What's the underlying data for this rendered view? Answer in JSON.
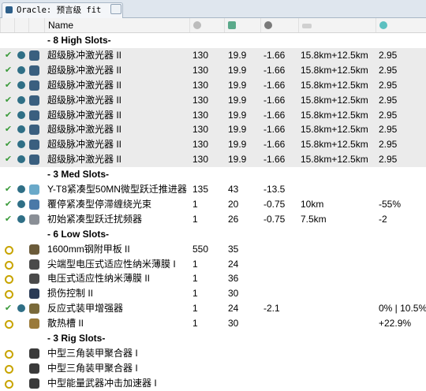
{
  "tab": {
    "title": "Oracle: 预言级 fit",
    "close": "x"
  },
  "columns": {
    "name": "Name"
  },
  "colors": {
    "row_highlight": "#ebebeb",
    "check": "#3a9a3a",
    "ring": "#c8a400"
  },
  "rows": [
    {
      "type": "section",
      "label": "- 8 High Slots-"
    },
    {
      "type": "module",
      "hl": true,
      "state": "check",
      "name": "超级脉冲激光器 II",
      "c1": "130",
      "c2": "19.9",
      "c3": "-1.66",
      "c4": "15.8km+12.5km",
      "c5": "2.95",
      "icon": "laser-icon"
    },
    {
      "type": "module",
      "hl": true,
      "state": "check",
      "name": "超级脉冲激光器 II",
      "c1": "130",
      "c2": "19.9",
      "c3": "-1.66",
      "c4": "15.8km+12.5km",
      "c5": "2.95",
      "icon": "laser-icon"
    },
    {
      "type": "module",
      "hl": true,
      "state": "check",
      "name": "超级脉冲激光器 II",
      "c1": "130",
      "c2": "19.9",
      "c3": "-1.66",
      "c4": "15.8km+12.5km",
      "c5": "2.95",
      "icon": "laser-icon"
    },
    {
      "type": "module",
      "hl": true,
      "state": "check",
      "name": "超级脉冲激光器 II",
      "c1": "130",
      "c2": "19.9",
      "c3": "-1.66",
      "c4": "15.8km+12.5km",
      "c5": "2.95",
      "icon": "laser-icon"
    },
    {
      "type": "module",
      "hl": true,
      "state": "check",
      "name": "超级脉冲激光器 II",
      "c1": "130",
      "c2": "19.9",
      "c3": "-1.66",
      "c4": "15.8km+12.5km",
      "c5": "2.95",
      "icon": "laser-icon"
    },
    {
      "type": "module",
      "hl": true,
      "state": "check",
      "name": "超级脉冲激光器 II",
      "c1": "130",
      "c2": "19.9",
      "c3": "-1.66",
      "c4": "15.8km+12.5km",
      "c5": "2.95",
      "icon": "laser-icon"
    },
    {
      "type": "module",
      "hl": true,
      "state": "check",
      "name": "超级脉冲激光器 II",
      "c1": "130",
      "c2": "19.9",
      "c3": "-1.66",
      "c4": "15.8km+12.5km",
      "c5": "2.95",
      "icon": "laser-icon"
    },
    {
      "type": "module",
      "hl": true,
      "state": "check",
      "name": "超级脉冲激光器 II",
      "c1": "130",
      "c2": "19.9",
      "c3": "-1.66",
      "c4": "15.8km+12.5km",
      "c5": "2.95",
      "icon": "laser-icon"
    },
    {
      "type": "section",
      "label": "- 3 Med Slots-"
    },
    {
      "type": "module",
      "hl": false,
      "state": "check",
      "name": "Y-T8紧凑型50MN微型跃迁推进器",
      "c1": "135",
      "c2": "43",
      "c3": "-13.5",
      "c4": "",
      "c5": "",
      "icon": "thruster-icon"
    },
    {
      "type": "module",
      "hl": false,
      "state": "check",
      "name": "覆停紧凑型停滞缠绕光束",
      "c1": "1",
      "c2": "20",
      "c3": "-0.75",
      "c4": "10km",
      "c5": "-55%",
      "icon": "web-icon"
    },
    {
      "type": "module",
      "hl": false,
      "state": "check",
      "name": "初始紧凑型跃迁扰频器",
      "c1": "1",
      "c2": "26",
      "c3": "-0.75",
      "c4": "7.5km",
      "c5": "-2",
      "icon": "scrambler-icon"
    },
    {
      "type": "section",
      "label": "- 6 Low Slots-"
    },
    {
      "type": "module",
      "hl": false,
      "state": "ring",
      "name": "1600mm钢附甲板 II",
      "c1": "550",
      "c2": "35",
      "c3": "",
      "c4": "",
      "c5": "",
      "icon": "armor-plate-icon"
    },
    {
      "type": "module",
      "hl": false,
      "state": "ring",
      "name": "尖端型电压式适应性纳米薄膜 I",
      "c1": "1",
      "c2": "24",
      "c3": "",
      "c4": "",
      "c5": "",
      "icon": "membrane-icon"
    },
    {
      "type": "module",
      "hl": false,
      "state": "ring",
      "name": "电压式适应性纳米薄膜 II",
      "c1": "1",
      "c2": "36",
      "c3": "",
      "c4": "",
      "c5": "",
      "icon": "membrane-icon"
    },
    {
      "type": "module",
      "hl": false,
      "state": "ring",
      "name": "损伤控制 II",
      "c1": "1",
      "c2": "30",
      "c3": "",
      "c4": "",
      "c5": "",
      "icon": "damage-control-icon"
    },
    {
      "type": "module",
      "hl": false,
      "state": "check",
      "name": "反应式装甲增强器",
      "c1": "1",
      "c2": "24",
      "c3": "-2.1",
      "c4": "",
      "c5": "0% | 10.5%",
      "icon": "armor-hardener-icon"
    },
    {
      "type": "module",
      "hl": false,
      "state": "ring",
      "name": "散热槽 II",
      "c1": "1",
      "c2": "30",
      "c3": "",
      "c4": "",
      "c5": "+22.9%",
      "icon": "heat-sink-icon"
    },
    {
      "type": "section",
      "label": "- 3 Rig Slots-"
    },
    {
      "type": "module",
      "hl": false,
      "state": "ring",
      "name": "中型三角装甲聚合器 I",
      "c1": "",
      "c2": "",
      "c3": "",
      "c4": "",
      "c5": "",
      "icon": "rig-icon"
    },
    {
      "type": "module",
      "hl": false,
      "state": "ring",
      "name": "中型三角装甲聚合器 I",
      "c1": "",
      "c2": "",
      "c3": "",
      "c4": "",
      "c5": "",
      "icon": "rig-icon"
    },
    {
      "type": "module",
      "hl": false,
      "state": "ring",
      "name": "中型能量武器冲击加速器 I",
      "c1": "",
      "c2": "",
      "c3": "",
      "c4": "",
      "c5": "",
      "icon": "rig-icon"
    }
  ]
}
